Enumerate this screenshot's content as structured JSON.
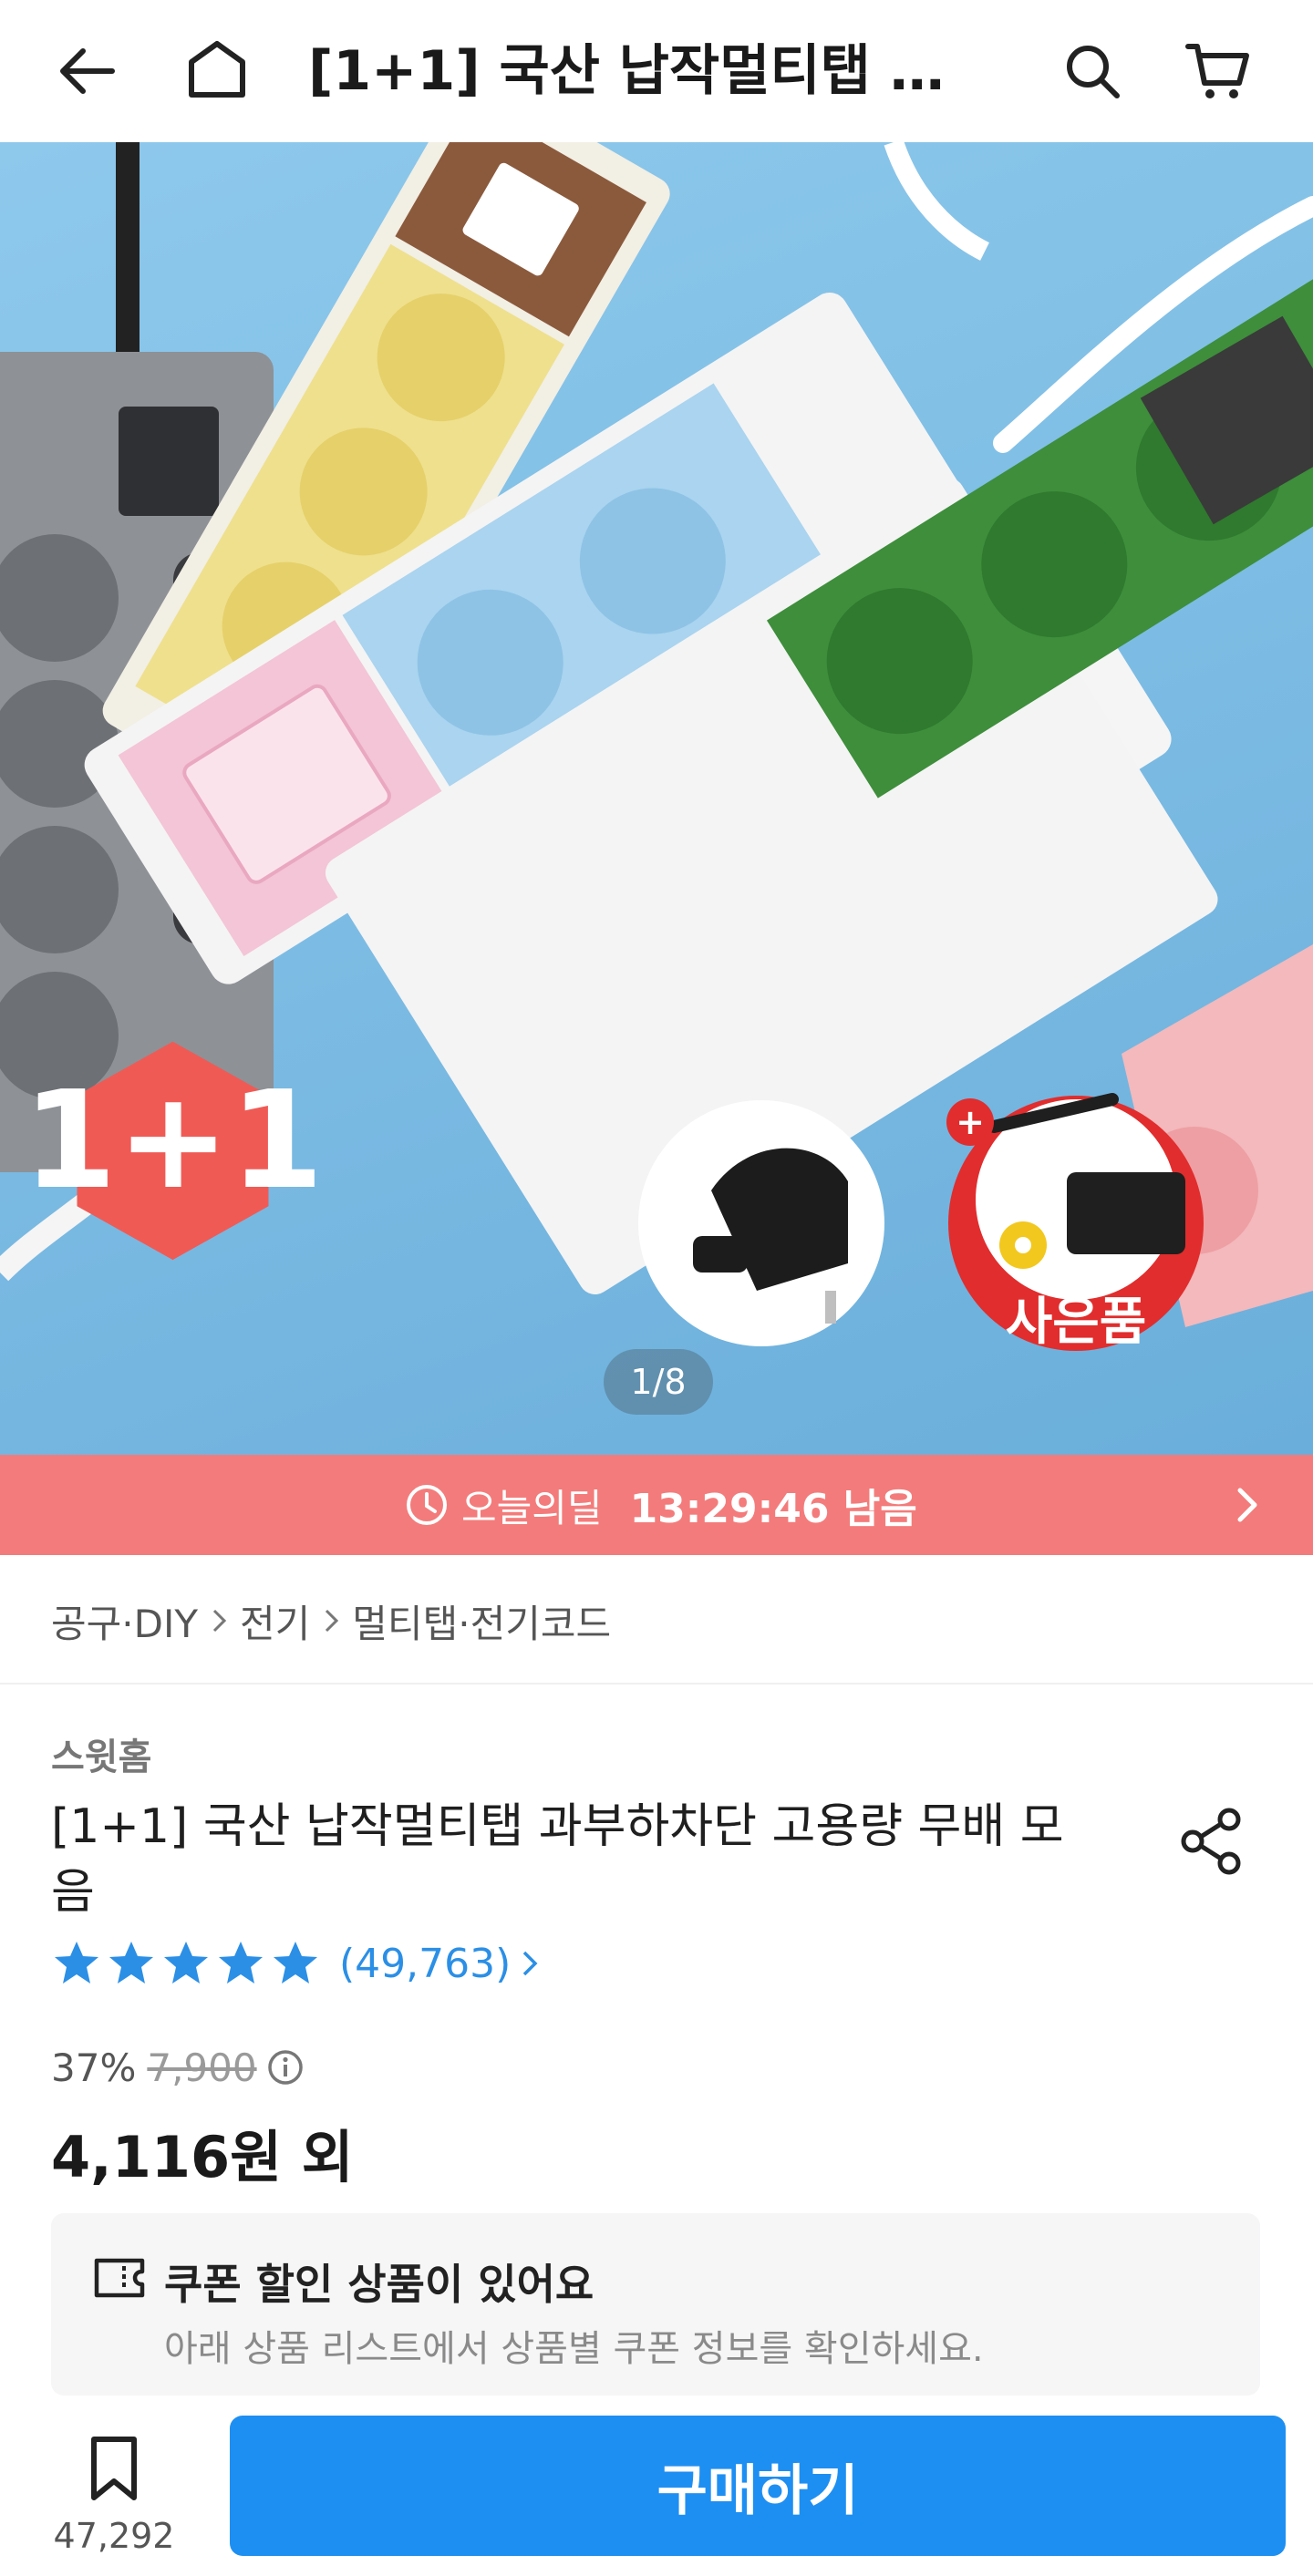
{
  "header": {
    "title": "[1+1] 국산 납작멀티탭 과부하차단 고용량 무배 모음",
    "icons": [
      "back-arrow-icon",
      "home-icon",
      "search-icon",
      "cart-icon"
    ]
  },
  "hero": {
    "badge": "1+1",
    "gift_label": "사은품",
    "page_indicator": "1/8"
  },
  "deal": {
    "label": "오늘의딜",
    "remaining": "13:29:46 남음",
    "color": "#f47b7b"
  },
  "breadcrumb": [
    "공구·DIY",
    "전기",
    "멀티탭·전기코드"
  ],
  "product": {
    "seller": "스윗홈",
    "title": "[1+1] 국산 납작멀티탭 과부하차단 고용량 무배 모음",
    "rating_stars": 5,
    "review_count": "(49,763)",
    "discount": "37%",
    "original_price": "7,900",
    "price": "4,116원 외"
  },
  "coupon": {
    "title": "쿠폰 할인 상품이 있어요",
    "subtitle": "아래 상품 리스트에서 상품별 쿠폰 정보를 확인하세요."
  },
  "bottom_bar": {
    "bookmark_count": "47,292",
    "buy_label": "구매하기",
    "accent": "#1e8ff2"
  }
}
